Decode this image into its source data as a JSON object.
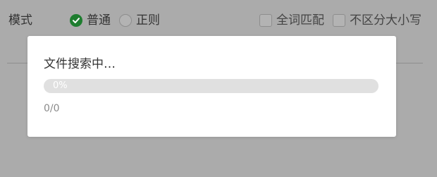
{
  "toolbar": {
    "mode_label": "模式",
    "modes": [
      {
        "label": "普通",
        "checked": true
      },
      {
        "label": "正则",
        "checked": false
      }
    ],
    "options": [
      {
        "label": "全词匹配",
        "checked": false
      },
      {
        "label": "不区分大小写",
        "checked": false
      }
    ]
  },
  "dialog": {
    "title": "文件搜索中…",
    "progress_percent": 0,
    "progress_text": "0%",
    "count_text": "0/0"
  },
  "colors": {
    "accent": "#1e7d2f",
    "overlay": "#ababab",
    "track": "#e0e0e0"
  }
}
